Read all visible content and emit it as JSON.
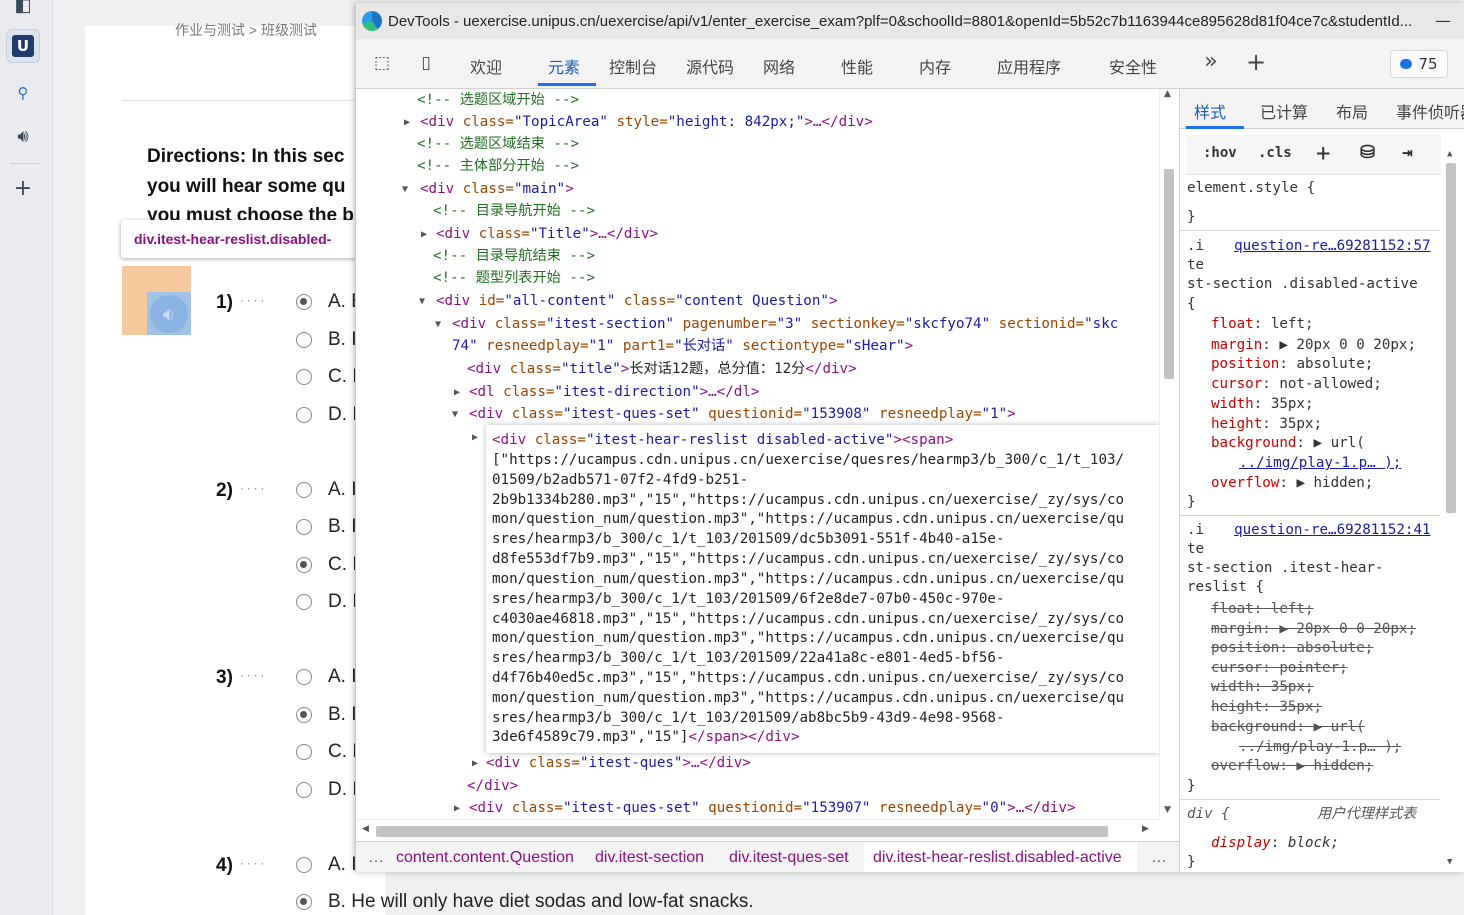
{
  "background_page": {
    "breadcrumb": "作业与测试  >  班级测试",
    "directions_lines": [
      "Directions: In this sec",
      "you will hear some qu",
      "you must choose the b"
    ],
    "hover_tooltip": "div.itest-hear-reslist.disabled-",
    "questions": [
      {
        "num": "1)",
        "options": [
          "A. E",
          "B. I",
          "C. I",
          "D. I"
        ],
        "selected": 0
      },
      {
        "num": "2)",
        "options": [
          "A. I",
          "B. I",
          "C. I",
          "D. I"
        ],
        "selected": 2
      },
      {
        "num": "3)",
        "options": [
          "A. I",
          "B. I",
          "C. I",
          "D. I"
        ],
        "selected": 1
      },
      {
        "num": "4)",
        "options": [
          "A. I",
          "B. He will only have diet sodas and low-fat snacks."
        ],
        "selected": 1
      }
    ]
  },
  "devtools": {
    "window_title": "DevTools - uexercise.unipus.cn/uexercise/api/v1/enter_exercise_exam?plf=0&schoolId=8801&openId=5b52c7b1163944ce895628d81f04ce7c&studentId...",
    "tabs": [
      "欢迎",
      "元素",
      "控制台",
      "源代码",
      "网络",
      "性能",
      "内存",
      "应用程序",
      "安全性"
    ],
    "active_tab": "元素",
    "issues_count": "75",
    "tree": {
      "l1": "<!-- 选题区域开始 -->",
      "l2_tag": "<div ",
      "l2_an": "class=",
      "l2_av": "\"TopicArea\"",
      "l2_an2": " style=",
      "l2_av2": "\"height: 842px;\"",
      "l2_end": ">…</div>",
      "l3": "<!-- 选题区域结束 -->",
      "l4": "<!-- 主体部分开始 -->",
      "l5_tag": "<div ",
      "l5_an": "class=",
      "l5_av": "\"main\"",
      "l5_end": ">",
      "l6": "<!-- 目录导航开始 -->",
      "l7_tag": "<div ",
      "l7_an": "class=",
      "l7_av": "\"Title\"",
      "l7_end": ">…</div>",
      "l8": "<!-- 目录导航结束 -->",
      "l9": "<!-- 题型列表开始 -->",
      "l10_tag": "<div ",
      "l10_an": "id=",
      "l10_av": "\"all-content\"",
      "l10_an2": " class=",
      "l10_av2": "\"content Question\"",
      "l10_end": ">",
      "l11_tag": "<div ",
      "l11_an": "class=",
      "l11_av": "\"itest-section\"",
      "l11_an2": " pagenumber=",
      "l11_av2": "\"3\"",
      "l11_an3": " sectionkey=",
      "l11_av3": "\"skcfyo74\"",
      "l11_an4": " sectionid=",
      "l11_av4": "\"skc",
      "l12_av": "74\"",
      "l12_an": " resneedplay=",
      "l12_av2": "\"1\"",
      "l12_an2": " part1=",
      "l12_av3": "\"长对话\"",
      "l12_an3": " sectiontype=",
      "l12_av4": "\"sHear\"",
      "l12_end": ">",
      "l13_tag": "<div ",
      "l13_an": "class=",
      "l13_av": "\"title\"",
      "l13_mid": ">",
      "l13_text": "长对话12题，总分值：12分",
      "l13_end": "</div>",
      "l14_tag": "<dl ",
      "l14_an": "class=",
      "l14_av": "\"itest-direction\"",
      "l14_end": ">…</dl>",
      "l15_tag": "<div ",
      "l15_an": "class=",
      "l15_av": "\"itest-ques-set\"",
      "l15_an2": " questionid=",
      "l15_av2": "\"153908\"",
      "l15_an3": " resneedplay=",
      "l15_av3": "\"1\"",
      "l15_end": ">",
      "popup_tag": "<div ",
      "popup_an": "class=",
      "popup_av": "\"itest-hear-reslist disabled-active\"",
      "popup_end": "><span>",
      "popup_text": [
        "[\"https://ucampus.cdn.unipus.cn/uexercise/quesres/hearmp3/b_300/c_1/t_103/",
        "01509/b2adb571-07f2-4fd9-b251-",
        "2b9b1334b280.mp3\",\"15\",\"https://ucampus.cdn.unipus.cn/uexercise/_zy/sys/co",
        "mon/question_num/question.mp3\",\"https://ucampus.cdn.unipus.cn/uexercise/qu",
        "sres/hearmp3/b_300/c_1/t_103/201509/dc5b3091-551f-4b40-a15e-",
        "d8fe553df7b9.mp3\",\"15\",\"https://ucampus.cdn.unipus.cn/uexercise/_zy/sys/co",
        "mon/question_num/question.mp3\",\"https://ucampus.cdn.unipus.cn/uexercise/qu",
        "sres/hearmp3/b_300/c_1/t_103/201509/6f2e8de7-07b0-450c-970e-",
        "c4030ae46818.mp3\",\"15\",\"https://ucampus.cdn.unipus.cn/uexercise/_zy/sys/co",
        "mon/question_num/question.mp3\",\"https://ucampus.cdn.unipus.cn/uexercise/qu",
        "sres/hearmp3/b_300/c_1/t_103/201509/22a41a8c-e801-4ed5-bf56-",
        "d4f76b40ed5c.mp3\",\"15\",\"https://ucampus.cdn.unipus.cn/uexercise/_zy/sys/co",
        "mon/question_num/question.mp3\",\"https://ucampus.cdn.unipus.cn/uexercise/qu",
        "sres/hearmp3/b_300/c_1/t_103/201509/ab8bc5b9-43d9-4e98-9568-"
      ],
      "popup_last_text": "3de6f4589c79.mp3\",\"15\"]",
      "popup_last_end": "</span></div>",
      "l17_tag": "<div ",
      "l17_an": "class=",
      "l17_av": "\"itest-ques\"",
      "l17_end": ">…</div>",
      "l18": "</div>",
      "l19_tag": "<div ",
      "l19_an": "class=",
      "l19_av": "\"itest-ques-set\"",
      "l19_an2": " questionid=",
      "l19_av2": "\"153907\"",
      "l19_an3": " resneedplay=",
      "l19_av3": "\"0\"",
      "l19_end": ">…</div>"
    },
    "breadcrumbs": [
      "…",
      "content.content.Question",
      "div.itest-section",
      "div.itest-ques-set",
      "div.itest-hear-reslist.disabled-active",
      "…"
    ],
    "styles": {
      "tabs": [
        "样式",
        "已计算",
        "布局",
        "事件侦听器"
      ],
      "active_tab": "样式",
      "tools": [
        ":hov",
        ".cls"
      ],
      "element_style": "element.style {",
      "close_brace": "}",
      "rule1": {
        "sel1": ".i",
        "link": "question-re…69281152:57",
        "sel2": "te",
        "sel3": "st-section .disabled-active",
        "open": "{",
        "props": [
          [
            "float",
            "left;"
          ],
          [
            "margin",
            "▶ 20px 0 0 20px;"
          ],
          [
            "position",
            "absolute;"
          ],
          [
            "cursor",
            "not-allowed;"
          ],
          [
            "width",
            "35px;"
          ],
          [
            "height",
            "35px;"
          ],
          [
            "background",
            "▶ url("
          ]
        ],
        "url_line": "../img/play-1.p… );",
        "overflow": [
          "overflow",
          "▶ hidden;"
        ]
      },
      "rule2": {
        "sel1": ".i",
        "link": "question-re…69281152:41",
        "sel2": "te",
        "sel3": "st-section .itest-hear-",
        "sel4": "reslist {",
        "props": [
          "float: left;",
          "margin: ▶ 20px 0 0 20px;",
          "position: absolute;",
          "cursor: pointer;",
          "width: 35px;",
          "height: 35px;",
          "background: ▶ url("
        ],
        "url_line": "../img/play-1.p… );",
        "overflow": "overflow: ▶ hidden;"
      },
      "ua_rule": {
        "sel": "div {",
        "label": "用户代理样式表",
        "prop": "display",
        "val": "block;"
      }
    }
  }
}
